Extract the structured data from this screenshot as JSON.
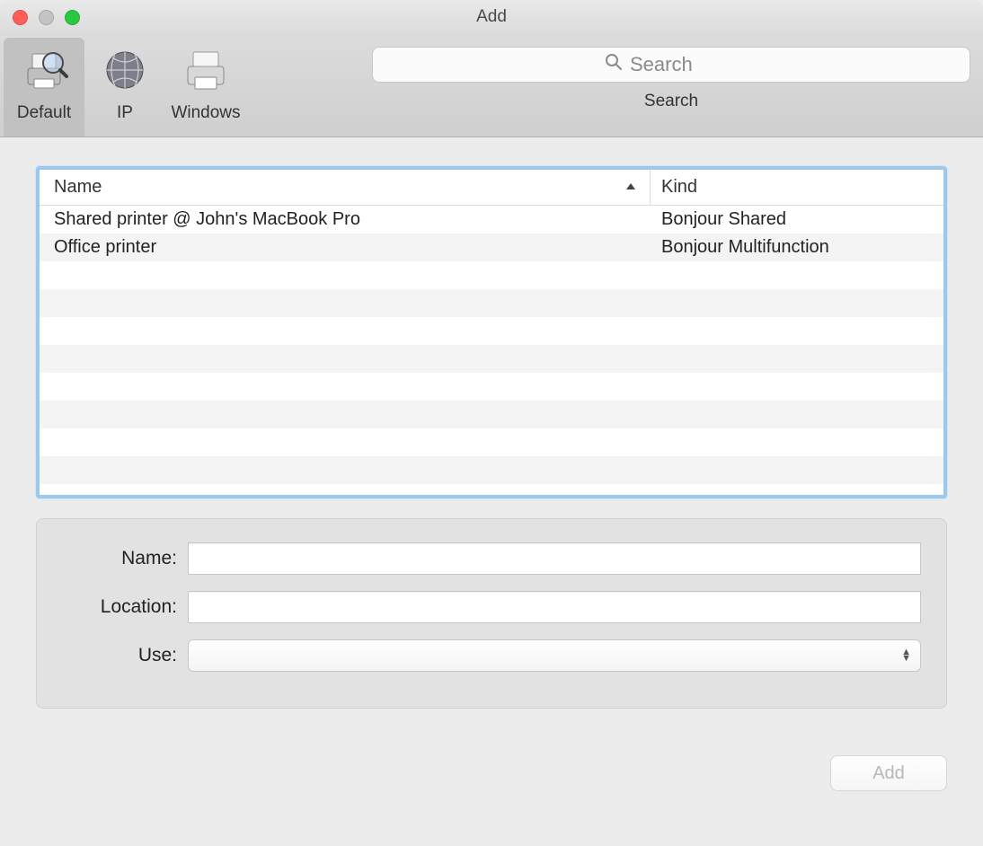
{
  "window": {
    "title": "Add"
  },
  "toolbar": {
    "items": [
      {
        "label": "Default",
        "selected": true
      },
      {
        "label": "IP",
        "selected": false
      },
      {
        "label": "Windows",
        "selected": false
      }
    ],
    "search": {
      "placeholder": "Search",
      "label": "Search"
    }
  },
  "printerList": {
    "columns": {
      "name": "Name",
      "kind": "Kind"
    },
    "rows": [
      {
        "name": "Shared printer @ John's MacBook Pro",
        "kind": "Bonjour Shared"
      },
      {
        "name": "Office printer",
        "kind": "Bonjour Multifunction"
      }
    ]
  },
  "form": {
    "nameLabel": "Name:",
    "nameValue": "",
    "locationLabel": "Location:",
    "locationValue": "",
    "useLabel": "Use:",
    "useValue": ""
  },
  "footer": {
    "addLabel": "Add"
  }
}
